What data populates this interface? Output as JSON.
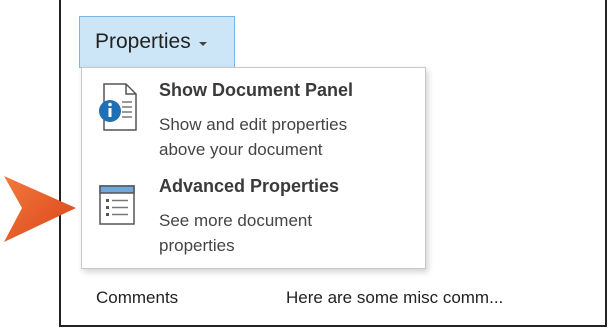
{
  "properties_button": {
    "label": "Properties"
  },
  "menu": {
    "items": [
      {
        "title": "Show Document Panel",
        "description_line1": "Show and edit properties",
        "description_line2": "above your document",
        "icon": "document-panel-icon"
      },
      {
        "title": "Advanced Properties",
        "description_line1": "See more document",
        "description_line2": "properties",
        "icon": "advanced-properties-icon"
      }
    ]
  },
  "background_row": {
    "label": "Comments",
    "value": "Here are some misc comm..."
  },
  "colors": {
    "button_bg": "#cde6f7",
    "button_border": "#79b8e6",
    "arrow": "#e8501e",
    "icon_blue": "#1f6fb5"
  }
}
